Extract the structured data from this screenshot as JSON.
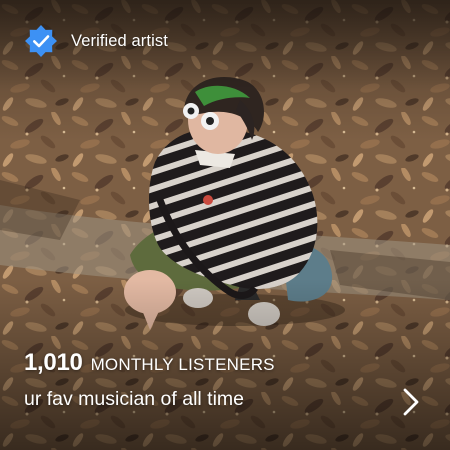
{
  "artist_card": {
    "verified_label": "Verified artist",
    "monthly_listeners_count": "1,010",
    "monthly_listeners_label": "MONTHLY LISTENERS",
    "bio": "ur fav musician of all time"
  },
  "icons": {
    "verified": "verified-badge-icon",
    "next": "chevron-right-icon"
  },
  "colors": {
    "verified_badge": "#3d91f4",
    "text": "#ffffff",
    "photo_ground": "#8a6a4c"
  }
}
